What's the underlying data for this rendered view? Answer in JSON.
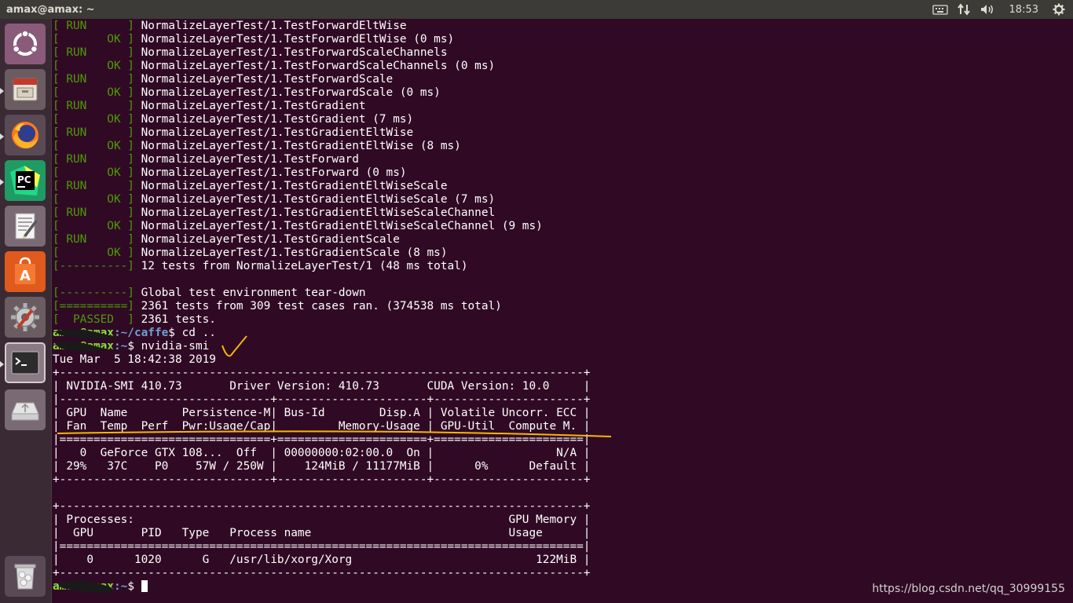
{
  "window": {
    "title": "amax@amax: ~"
  },
  "panel": {
    "clock": "18:53",
    "icons": [
      "keyboard-icon",
      "network-icon",
      "volume-icon",
      "power-gear-icon"
    ]
  },
  "launcher": {
    "items": [
      {
        "name": "ubuntu-dash-icon"
      },
      {
        "name": "files-icon"
      },
      {
        "name": "firefox-icon"
      },
      {
        "name": "pycharm-icon",
        "label": "PC"
      },
      {
        "name": "text-editor-icon"
      },
      {
        "name": "software-center-icon"
      },
      {
        "name": "system-settings-icon"
      },
      {
        "name": "terminal-icon"
      },
      {
        "name": "usb-drive-icon"
      },
      {
        "name": "trash-icon"
      }
    ]
  },
  "colors": {
    "background": "#300a24",
    "green": "#4e9a06",
    "prompt": "#8ae234",
    "path": "#729fcf",
    "highlight": "#f5b800"
  },
  "terminal": {
    "lines": [
      {
        "tag": "[ RUN      ]",
        "text": " NormalizeLayerTest/1.TestForwardEltWise"
      },
      {
        "tag": "[       OK ]",
        "text": " NormalizeLayerTest/1.TestForwardEltWise (0 ms)"
      },
      {
        "tag": "[ RUN      ]",
        "text": " NormalizeLayerTest/1.TestForwardScaleChannels"
      },
      {
        "tag": "[       OK ]",
        "text": " NormalizeLayerTest/1.TestForwardScaleChannels (0 ms)"
      },
      {
        "tag": "[ RUN      ]",
        "text": " NormalizeLayerTest/1.TestForwardScale"
      },
      {
        "tag": "[       OK ]",
        "text": " NormalizeLayerTest/1.TestForwardScale (0 ms)"
      },
      {
        "tag": "[ RUN      ]",
        "text": " NormalizeLayerTest/1.TestGradient"
      },
      {
        "tag": "[       OK ]",
        "text": " NormalizeLayerTest/1.TestGradient (7 ms)"
      },
      {
        "tag": "[ RUN      ]",
        "text": " NormalizeLayerTest/1.TestGradientEltWise"
      },
      {
        "tag": "[       OK ]",
        "text": " NormalizeLayerTest/1.TestGradientEltWise (8 ms)"
      },
      {
        "tag": "[ RUN      ]",
        "text": " NormalizeLayerTest/1.TestForward"
      },
      {
        "tag": "[       OK ]",
        "text": " NormalizeLayerTest/1.TestForward (0 ms)"
      },
      {
        "tag": "[ RUN      ]",
        "text": " NormalizeLayerTest/1.TestGradientEltWiseScale"
      },
      {
        "tag": "[       OK ]",
        "text": " NormalizeLayerTest/1.TestGradientEltWiseScale (7 ms)"
      },
      {
        "tag": "[ RUN      ]",
        "text": " NormalizeLayerTest/1.TestGradientEltWiseScaleChannel"
      },
      {
        "tag": "[       OK ]",
        "text": " NormalizeLayerTest/1.TestGradientEltWiseScaleChannel (9 ms)"
      },
      {
        "tag": "[ RUN      ]",
        "text": " NormalizeLayerTest/1.TestGradientScale"
      },
      {
        "tag": "[       OK ]",
        "text": " NormalizeLayerTest/1.TestGradientScale (8 ms)"
      },
      {
        "tag": "[----------]",
        "text": " 12 tests from NormalizeLayerTest/1 (48 ms total)"
      },
      {
        "text": ""
      },
      {
        "tag": "[----------]",
        "text": " Global test environment tear-down"
      },
      {
        "tag": "[==========]",
        "text": " 2361 tests from 309 test cases ran. (374538 ms total)"
      },
      {
        "tag": "[  PASSED  ]",
        "text": " 2361 tests."
      },
      {
        "prompt": "amax@amax",
        "path": ":~/caffe",
        "text": "$ cd .."
      },
      {
        "prompt": "amax@amax",
        "path": ":~",
        "text": "$ nvidia-smi"
      },
      {
        "text": "Tue Mar  5 18:42:38 2019"
      },
      {
        "text": "+-----------------------------------------------------------------------------+"
      },
      {
        "text": "| NVIDIA-SMI 410.73       Driver Version: 410.73       CUDA Version: 10.0     |"
      },
      {
        "text": "|-------------------------------+----------------------+----------------------+"
      },
      {
        "text": "| GPU  Name        Persistence-M| Bus-Id        Disp.A | Volatile Uncorr. ECC |"
      },
      {
        "text": "| Fan  Temp  Perf  Pwr:Usage/Cap|         Memory-Usage | GPU-Util  Compute M. |"
      },
      {
        "text": "|===============================+======================+======================|"
      },
      {
        "text": "|   0  GeForce GTX 108...  Off  | 00000000:02:00.0  On |                  N/A |"
      },
      {
        "text": "| 29%   37C    P0    57W / 250W |    124MiB / 11177MiB |      0%      Default |"
      },
      {
        "text": "+-------------------------------+----------------------+----------------------+"
      },
      {
        "text": ""
      },
      {
        "text": "+-----------------------------------------------------------------------------+"
      },
      {
        "text": "| Processes:                                                       GPU Memory |"
      },
      {
        "text": "|  GPU       PID   Type   Process name                             Usage      |"
      },
      {
        "text": "|=============================================================================|"
      },
      {
        "text": "|    0      1020      G   /usr/lib/xorg/Xorg                           122MiB |"
      },
      {
        "text": "+-----------------------------------------------------------------------------+"
      },
      {
        "prompt": "amax@amax",
        "path": ":~",
        "text": "$ ",
        "cursor": true
      }
    ]
  },
  "watermark": "https://blog.csdn.net/qq_30999155"
}
